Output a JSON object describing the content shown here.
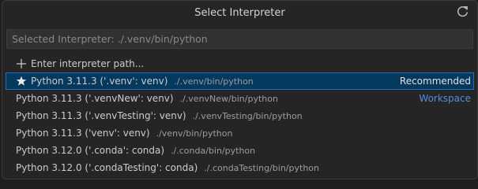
{
  "header": {
    "title": "Select Interpreter",
    "refresh_icon": "refresh-icon"
  },
  "search": {
    "placeholder": "Selected Interpreter: ./.venv/bin/python"
  },
  "enter_path": {
    "icon": "plus-icon",
    "label": "Enter interpreter path..."
  },
  "items": [
    {
      "label": "Python 3.11.3 ('.venv': venv)",
      "path": "./.venv/bin/python",
      "tag": "Recommended",
      "starred": true,
      "selected": true
    },
    {
      "label": "Python 3.11.3 ('.venvNew': venv)",
      "path": "./.venvNew/bin/python",
      "tag": "Workspace"
    },
    {
      "label": "Python 3.11.3 ('.venvTesting': venv)",
      "path": "./.venvTesting/bin/python"
    },
    {
      "label": "Python 3.11.3 ('venv': venv)",
      "path": "./venv/bin/python"
    },
    {
      "label": "Python 3.12.0 ('.conda': conda)",
      "path": "./.conda/bin/python"
    },
    {
      "label": "Python 3.12.0 ('.condaTesting': conda)",
      "path": "./.condaTesting/bin/python"
    }
  ],
  "colors": {
    "selection_bg": "#04395e",
    "selection_border": "#1f70c1",
    "link": "#4f8fdc"
  }
}
